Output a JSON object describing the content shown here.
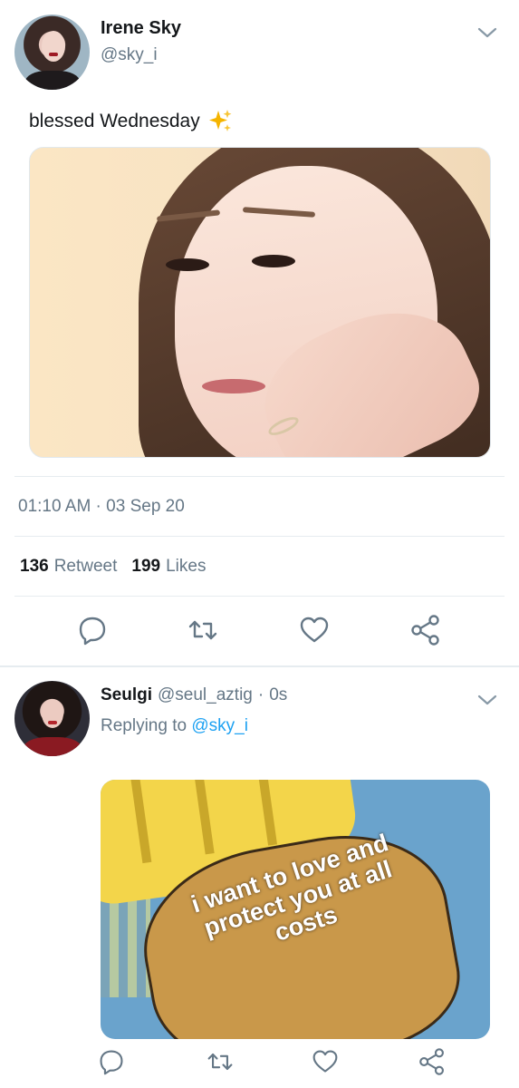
{
  "tweet": {
    "author_name": "Irene Sky",
    "author_handle": "@sky_i",
    "text": "blessed Wednesday",
    "text_emoji": "sparkles-icon",
    "timestamp": "01:10 AM · 03 Sep 20",
    "stats": {
      "retweets_count": "136",
      "retweets_label": "Retweet",
      "likes_count": "199",
      "likes_label": "Likes"
    },
    "actions": [
      "reply-icon",
      "retweet-icon",
      "like-icon",
      "share-icon"
    ]
  },
  "reply": {
    "author_name": "Seulgi",
    "author_handle": "@seul_aztig",
    "separator": "·",
    "time": "0s",
    "replying_prefix": "Replying to",
    "replying_to": "@sky_i",
    "meme_text": "i want to love and protect you at all costs",
    "actions": [
      "reply-icon",
      "retweet-icon",
      "like-icon",
      "share-icon"
    ]
  },
  "colors": {
    "muted": "#657786",
    "link": "#1da1f2",
    "text": "#14171a",
    "divider": "#e6ecf0"
  }
}
